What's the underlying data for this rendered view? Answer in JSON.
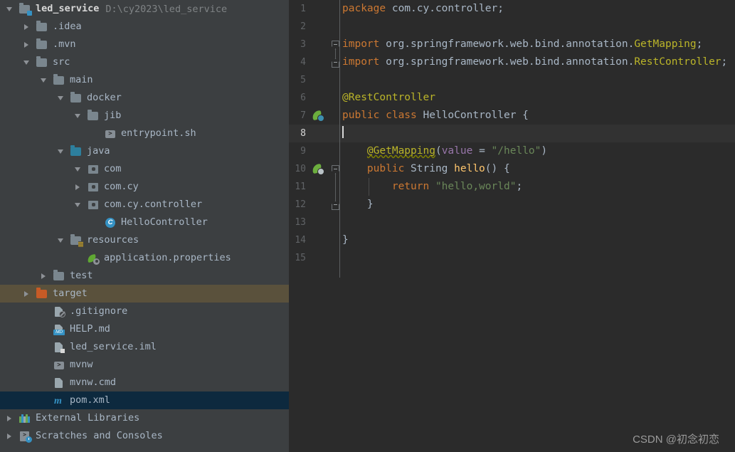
{
  "sidebar": {
    "name": "project-tree",
    "rows": [
      {
        "label": "led_service",
        "path": "D:\\cy2023\\led_service",
        "depth": 0,
        "arrow": "down",
        "icon": "folder-module-icon",
        "bold": true,
        "state": "normal"
      },
      {
        "label": ".idea",
        "depth": 1,
        "arrow": "right",
        "icon": "folder-icon",
        "state": "normal"
      },
      {
        "label": ".mvn",
        "depth": 1,
        "arrow": "right",
        "icon": "folder-icon",
        "state": "normal"
      },
      {
        "label": "src",
        "depth": 1,
        "arrow": "down",
        "icon": "folder-icon",
        "state": "normal"
      },
      {
        "label": "main",
        "depth": 2,
        "arrow": "down",
        "icon": "folder-icon",
        "state": "normal"
      },
      {
        "label": "docker",
        "depth": 3,
        "arrow": "down",
        "icon": "folder-icon",
        "state": "normal"
      },
      {
        "label": "jib",
        "depth": 4,
        "arrow": "down",
        "icon": "folder-icon",
        "state": "normal"
      },
      {
        "label": "entrypoint.sh",
        "depth": 5,
        "arrow": "none",
        "icon": "shell-script-icon",
        "state": "normal"
      },
      {
        "label": "java",
        "depth": 3,
        "arrow": "down",
        "icon": "folder-source-root-icon",
        "state": "normal"
      },
      {
        "label": "com",
        "depth": 4,
        "arrow": "down",
        "icon": "package-icon",
        "state": "normal"
      },
      {
        "label": "com.cy",
        "depth": 4,
        "arrow": "right",
        "icon": "package-icon",
        "state": "normal"
      },
      {
        "label": "com.cy.controller",
        "depth": 4,
        "arrow": "down",
        "icon": "package-icon",
        "state": "normal"
      },
      {
        "label": "HelloController",
        "depth": 5,
        "arrow": "none",
        "icon": "java-class-icon",
        "state": "normal"
      },
      {
        "label": "resources",
        "depth": 3,
        "arrow": "down",
        "icon": "folder-resources-icon",
        "state": "normal"
      },
      {
        "label": "application.properties",
        "depth": 4,
        "arrow": "none",
        "icon": "spring-properties-icon",
        "state": "normal"
      },
      {
        "label": "test",
        "depth": 2,
        "arrow": "right",
        "icon": "folder-icon",
        "state": "normal"
      },
      {
        "label": "target",
        "depth": 1,
        "arrow": "right",
        "icon": "folder-excluded-icon",
        "state": "hover"
      },
      {
        "label": ".gitignore",
        "depth": 2,
        "arrow": "none",
        "icon": "gitignore-file-icon",
        "state": "normal"
      },
      {
        "label": "HELP.md",
        "depth": 2,
        "arrow": "none",
        "icon": "markdown-file-icon",
        "state": "normal"
      },
      {
        "label": "led_service.iml",
        "depth": 2,
        "arrow": "none",
        "icon": "iml-file-icon",
        "state": "normal"
      },
      {
        "label": "mvnw",
        "depth": 2,
        "arrow": "none",
        "icon": "shell-script-icon",
        "state": "normal"
      },
      {
        "label": "mvnw.cmd",
        "depth": 2,
        "arrow": "none",
        "icon": "cmd-file-icon",
        "state": "normal"
      },
      {
        "label": "pom.xml",
        "depth": 2,
        "arrow": "none",
        "icon": "maven-pom-icon",
        "state": "selected"
      },
      {
        "label": "External Libraries",
        "depth": 0,
        "arrow": "right",
        "icon": "libraries-icon",
        "state": "normal"
      },
      {
        "label": "Scratches and Consoles",
        "depth": 0,
        "arrow": "right",
        "icon": "scratches-icon",
        "state": "normal"
      }
    ]
  },
  "editor": {
    "name": "code-editor",
    "file": "HelloController",
    "lines": [
      {
        "n": "1",
        "spring": "none",
        "fold": "none",
        "current": false,
        "indent": 0,
        "tokens": [
          {
            "t": "package ",
            "c": "kw"
          },
          {
            "t": "com.cy.controller;",
            "c": "id"
          }
        ]
      },
      {
        "n": "2",
        "spring": "none",
        "fold": "none",
        "current": false,
        "indent": 0,
        "tokens": []
      },
      {
        "n": "3",
        "spring": "none",
        "fold": "top",
        "current": false,
        "indent": 0,
        "tokens": [
          {
            "t": "import ",
            "c": "kw"
          },
          {
            "t": "org.springframework.web.bind.annotation.",
            "c": "id"
          },
          {
            "t": "GetMapping",
            "c": "anno"
          },
          {
            "t": ";",
            "c": "id"
          }
        ]
      },
      {
        "n": "4",
        "spring": "none",
        "fold": "bot",
        "current": false,
        "indent": 0,
        "tokens": [
          {
            "t": "import ",
            "c": "kw"
          },
          {
            "t": "org.springframework.web.bind.annotation.",
            "c": "id"
          },
          {
            "t": "RestController",
            "c": "anno"
          },
          {
            "t": ";",
            "c": "id"
          }
        ]
      },
      {
        "n": "5",
        "spring": "none",
        "fold": "none",
        "current": false,
        "indent": 0,
        "tokens": []
      },
      {
        "n": "6",
        "spring": "none",
        "fold": "none",
        "current": false,
        "indent": 0,
        "tokens": [
          {
            "t": "@RestController",
            "c": "anno"
          }
        ]
      },
      {
        "n": "7",
        "spring": "bean",
        "fold": "none",
        "current": false,
        "indent": 0,
        "tokens": [
          {
            "t": "public ",
            "c": "kw"
          },
          {
            "t": "class ",
            "c": "kw"
          },
          {
            "t": "HelloController",
            "c": "cls2"
          },
          {
            "t": " {",
            "c": "id"
          }
        ]
      },
      {
        "n": "8",
        "spring": "none",
        "fold": "none",
        "current": true,
        "indent": 0,
        "tokens": [
          {
            "t": "",
            "c": "caret"
          }
        ]
      },
      {
        "n": "9",
        "spring": "none",
        "fold": "none",
        "current": false,
        "indent": 1,
        "tokens": [
          {
            "t": "    ",
            "c": "id"
          },
          {
            "t": "@GetMapping",
            "c": "anno-u"
          },
          {
            "t": "(",
            "c": "id"
          },
          {
            "t": "value",
            "c": "param"
          },
          {
            "t": " = ",
            "c": "id"
          },
          {
            "t": "\"/hello\"",
            "c": "str"
          },
          {
            "t": ")",
            "c": "id"
          }
        ]
      },
      {
        "n": "10",
        "spring": "bean-gray",
        "fold": "top",
        "current": false,
        "indent": 1,
        "tokens": [
          {
            "t": "    ",
            "c": "id"
          },
          {
            "t": "public ",
            "c": "kw"
          },
          {
            "t": "String ",
            "c": "cls2"
          },
          {
            "t": "hello",
            "c": "mname"
          },
          {
            "t": "() {",
            "c": "id"
          }
        ]
      },
      {
        "n": "11",
        "spring": "none",
        "fold": "none",
        "current": false,
        "indent": 2,
        "tokens": [
          {
            "t": "        ",
            "c": "id"
          },
          {
            "t": "return ",
            "c": "kw"
          },
          {
            "t": "\"hello,world\"",
            "c": "str"
          },
          {
            "t": ";",
            "c": "id"
          }
        ]
      },
      {
        "n": "12",
        "spring": "none",
        "fold": "bot",
        "current": false,
        "indent": 1,
        "tokens": [
          {
            "t": "    }",
            "c": "id"
          }
        ]
      },
      {
        "n": "13",
        "spring": "none",
        "fold": "none",
        "current": false,
        "indent": 0,
        "tokens": []
      },
      {
        "n": "14",
        "spring": "none",
        "fold": "none",
        "current": false,
        "indent": 0,
        "tokens": [
          {
            "t": "}",
            "c": "id"
          }
        ]
      },
      {
        "n": "15",
        "spring": "none",
        "fold": "none",
        "current": false,
        "indent": 0,
        "tokens": []
      }
    ]
  },
  "watermark": {
    "text": "CSDN @初念初恋"
  },
  "colors": {
    "sidebar_bg": "#3c3f41",
    "editor_bg": "#2b2b2b",
    "selection_bg": "#0d293e",
    "hover_bg": "#5a513c",
    "keyword": "#cc7832",
    "string": "#6a8759",
    "annotation": "#bbb529",
    "method": "#ffc66d",
    "param": "#9876aa",
    "text": "#a9b7c6"
  }
}
